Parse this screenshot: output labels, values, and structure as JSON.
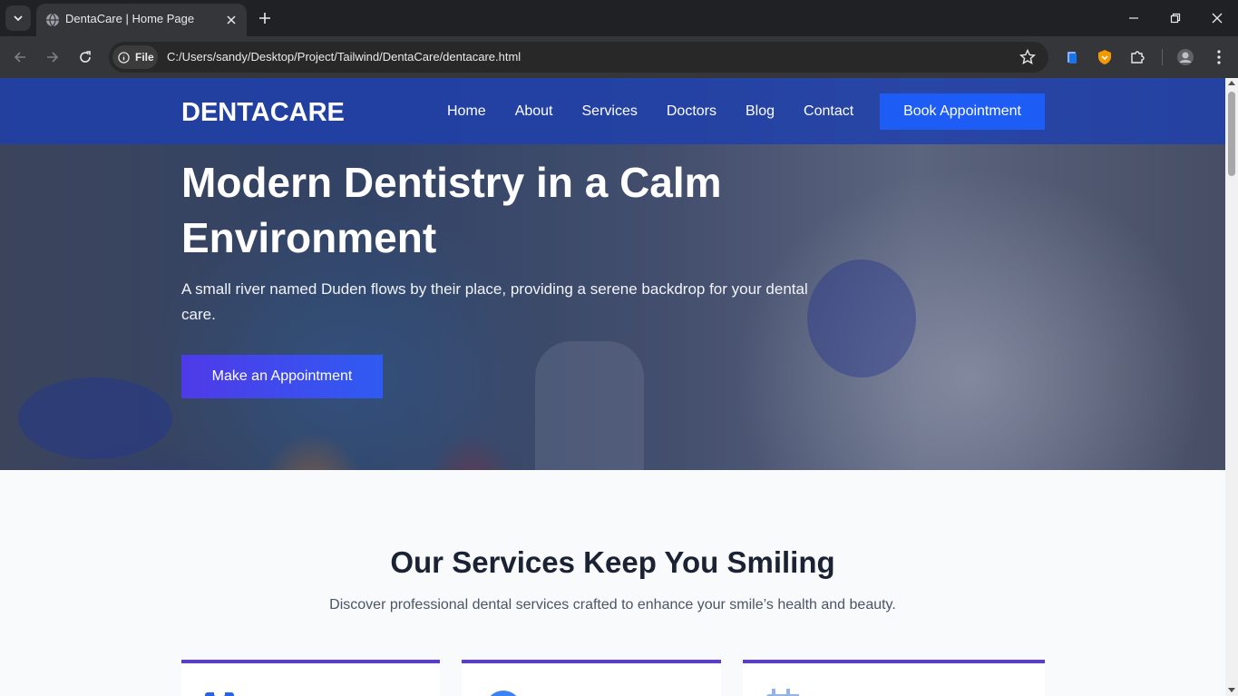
{
  "browser": {
    "tab_title": "DentaCare | Home Page",
    "site_chip": "File",
    "url": "C:/Users/sandy/Desktop/Project/Tailwind/DentaCare/dentacare.html"
  },
  "nav": {
    "logo": "DENTACARE",
    "links": [
      "Home",
      "About",
      "Services",
      "Doctors",
      "Blog",
      "Contact"
    ],
    "book_button": "Book Appointment"
  },
  "hero": {
    "title": "Modern Dentistry in a Calm Environment",
    "subtitle": "A small river named Duden flows by their place, providing a serene backdrop for your dental care.",
    "cta": "Make an Appointment"
  },
  "services": {
    "title": "Our Services Keep You Smiling",
    "subtitle": "Discover professional dental services crafted to enhance your smile’s health and beauty.",
    "card_icons": [
      "clipboard-icon",
      "circle-icon",
      "calendar-icon"
    ]
  },
  "colors": {
    "navbar": "#1d40af",
    "primary": "#1d5cf5",
    "accent": "#5b3bd8",
    "heading": "#1a2233"
  }
}
